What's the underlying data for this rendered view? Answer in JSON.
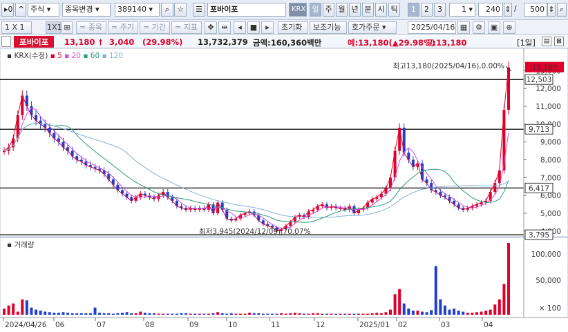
{
  "toolbar1": {
    "market": "주식",
    "change_label": "종목변경",
    "code": "389140",
    "name": "포바이포",
    "exchange": "KRX",
    "periods": [
      "일",
      "주",
      "월",
      "년",
      "분",
      "시",
      "틱"
    ],
    "numbers": [
      "1",
      "2",
      "3"
    ],
    "multiplier": "1",
    "count": "240",
    "total": "500"
  },
  "toolbar2": {
    "layout": "1 X 1",
    "layout2": "1X1",
    "items": [
      "종목",
      "주기",
      "기간",
      "지표"
    ],
    "reset": "초기화",
    "aux": "보조기능",
    "order": "호가주문",
    "date": "2025/04/16"
  },
  "info": {
    "name": "포바이포",
    "price": "13,180",
    "change": "3,040",
    "change_pct": "(29.98%)",
    "volume": "13,732,379",
    "amount": "금액:160,360백만",
    "forecast": "예:13,180(▲29.98%)",
    "high": "고:13,180",
    "period_badge": "[1일]"
  },
  "chart_data": {
    "type": "candlestick",
    "legend": {
      "main": "KRX(수정)",
      "ma": [
        "5",
        "20",
        "60",
        "120"
      ],
      "ma_colors": [
        "#e0002a",
        "#d64ad6",
        "#2a9a7a",
        "#7fb0d8"
      ]
    },
    "price_axis": [
      "13,000",
      "12,000",
      "11,000",
      "10,000",
      "9,000",
      "8,000",
      "7,000",
      "6,000",
      "5,000",
      "4,000"
    ],
    "ylim": [
      3800,
      13400
    ],
    "hlines": [
      12503,
      9713,
      6417,
      3795
    ],
    "hline_labels": [
      "12,503",
      "9,713",
      "6,417",
      "3,795"
    ],
    "current": "13,180",
    "high_annotation": "최고13,180(2025/04/16),0.00%",
    "low_annotation": "최저3,945(2024/12/09),70.07%",
    "x_labels": [
      "2024/04/26",
      "06",
      "07",
      "08",
      "09",
      "10",
      "11",
      "12",
      "2025/01",
      "02",
      "03",
      "04"
    ],
    "series_close": [
      8500,
      8700,
      9200,
      10500,
      11600,
      11000,
      10500,
      10200,
      10000,
      9800,
      9500,
      9200,
      9000,
      8700,
      8500,
      8200,
      8000,
      7900,
      7700,
      7600,
      7500,
      7400,
      7200,
      6900,
      6600,
      6300,
      6100,
      5900,
      5700,
      5900,
      6100,
      6000,
      5900,
      5800,
      6000,
      6200,
      5900,
      5700,
      5400,
      5300,
      5200,
      5300,
      5200,
      5300,
      5200,
      5500,
      5000,
      5600,
      5200,
      4700,
      4600,
      4700,
      4900,
      5000,
      5100,
      4900,
      4600,
      4400,
      4300,
      4200,
      4000,
      4100,
      4300,
      4500,
      4800,
      4900,
      4800,
      5100,
      5200,
      5400,
      5500,
      5300,
      5400,
      5300,
      5300,
      5200,
      5400,
      5000,
      5200,
      5300,
      5600,
      5800,
      5900,
      6100,
      6400,
      7000,
      8500,
      9800,
      8400,
      8000,
      7600,
      7800,
      6900,
      6700,
      6300,
      6200,
      6000,
      5900,
      5700,
      5500,
      5300,
      5200,
      5300,
      5400,
      5500,
      5600,
      5700,
      6200,
      6700,
      7400,
      10800,
      13180
    ],
    "volume_label": "거래량",
    "volume_axis": [
      "100,000",
      "50,000",
      "× 100"
    ],
    "volume": [
      12,
      18,
      22,
      6,
      30,
      28,
      14,
      10,
      8,
      6,
      5,
      4,
      4,
      5,
      4,
      3,
      3,
      3,
      3,
      3,
      14,
      4,
      3,
      3,
      2,
      3,
      4,
      5,
      3,
      3,
      6,
      4,
      3,
      3,
      2,
      2,
      2,
      2,
      2,
      3,
      3,
      2,
      2,
      2,
      2,
      2,
      3,
      5,
      3,
      2,
      3,
      2,
      2,
      2,
      4,
      3,
      3,
      2,
      2,
      2,
      2,
      3,
      2,
      3,
      4,
      3,
      2,
      2,
      3,
      3,
      2,
      2,
      2,
      2,
      2,
      2,
      2,
      2,
      2,
      2,
      2,
      3,
      4,
      3,
      5,
      10,
      40,
      50,
      22,
      12,
      8,
      8,
      6,
      5,
      9,
      95,
      30,
      18,
      10,
      12,
      8,
      6,
      4,
      4,
      5,
      6,
      8,
      10,
      20,
      30,
      60,
      140
    ]
  }
}
